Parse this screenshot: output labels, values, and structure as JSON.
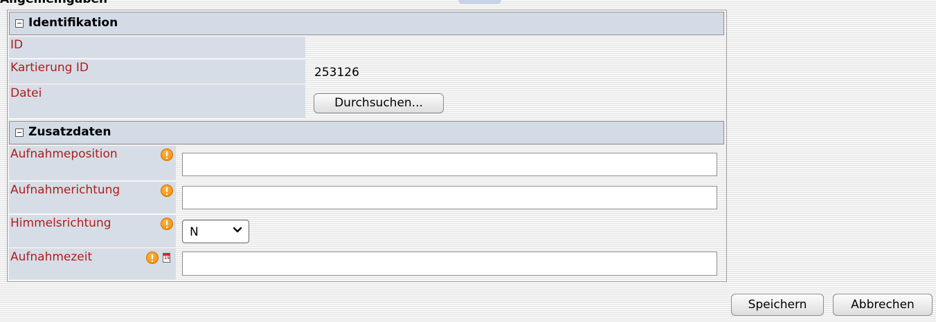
{
  "page": {
    "cut_heading": "Allgemeingaben"
  },
  "sections": {
    "identifikation": {
      "title": "Identifikation",
      "fields": {
        "id": {
          "label": "ID",
          "value": ""
        },
        "kartierung_id": {
          "label": "Kartierung ID",
          "value": "253126"
        },
        "datei": {
          "label": "Datei",
          "button_label": "Durchsuchen..."
        }
      }
    },
    "zusatzdaten": {
      "title": "Zusatzdaten",
      "fields": {
        "aufnahmeposition": {
          "label": "Aufnahmeposition",
          "value": ""
        },
        "aufnahmerichtung": {
          "label": "Aufnahmerichtung",
          "value": ""
        },
        "himmelsrichtung": {
          "label": "Himmelsrichtung",
          "selected": "N"
        },
        "aufnahmezeit": {
          "label": "Aufnahmezeit",
          "value": "",
          "calendar_day": "15"
        }
      }
    }
  },
  "actions": {
    "save_label": "Speichern",
    "cancel_label": "Abbrechen"
  },
  "icons": {
    "toggle": "collapse-icon",
    "required": "warning-icon",
    "calendar": "calendar-icon",
    "dropdown": "chevron-down-icon"
  },
  "colors": {
    "label_text": "#b01c1c",
    "section_header_bg": "#d3dbe6",
    "label_cell_bg": "#d7dde6",
    "warning_orange": "#f08a00"
  }
}
